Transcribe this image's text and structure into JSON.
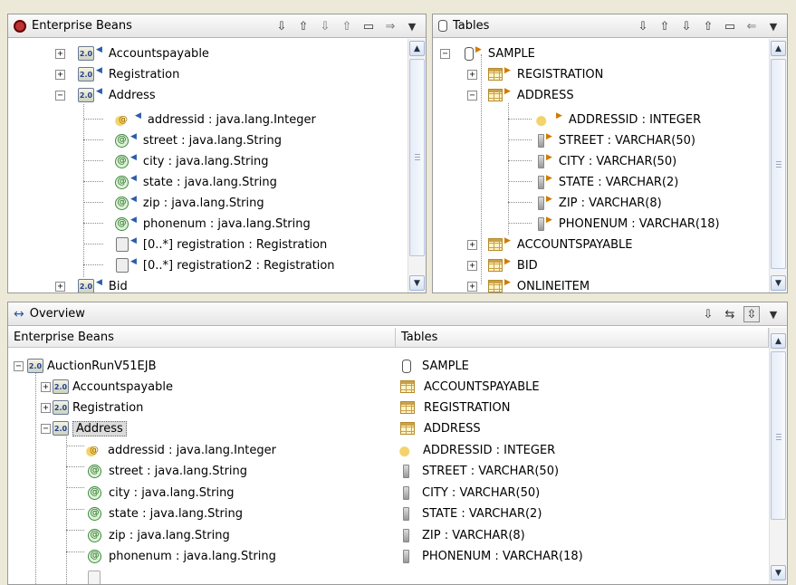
{
  "beans_panel": {
    "title": "Enterprise Beans",
    "rows": [
      {
        "label": "Accountspayable",
        "badge": "2.0"
      },
      {
        "label": "Registration",
        "badge": "2.0"
      },
      {
        "label": "Address",
        "badge": "2.0"
      },
      {
        "label": "addressid : java.lang.Integer",
        "badge": "@"
      },
      {
        "label": "street : java.lang.String",
        "badge": "@"
      },
      {
        "label": "city : java.lang.String",
        "badge": "@"
      },
      {
        "label": "state : java.lang.String",
        "badge": "@"
      },
      {
        "label": "zip : java.lang.String",
        "badge": "@"
      },
      {
        "label": "phonenum : java.lang.String",
        "badge": "@"
      },
      {
        "label": "[0..*] registration : Registration"
      },
      {
        "label": "[0..*] registration2 : Registration"
      },
      {
        "label": "Bid",
        "badge": "2.0"
      }
    ]
  },
  "tables_panel": {
    "title": "Tables",
    "rows": [
      {
        "label": "SAMPLE"
      },
      {
        "label": "REGISTRATION"
      },
      {
        "label": "ADDRESS"
      },
      {
        "label": "ADDRESSID : INTEGER"
      },
      {
        "label": "STREET : VARCHAR(50)"
      },
      {
        "label": "CITY : VARCHAR(50)"
      },
      {
        "label": "STATE : VARCHAR(2)"
      },
      {
        "label": "ZIP : VARCHAR(8)"
      },
      {
        "label": "PHONENUM : VARCHAR(18)"
      },
      {
        "label": "ACCOUNTSPAYABLE"
      },
      {
        "label": "BID"
      },
      {
        "label": "ONLINEITEM"
      }
    ]
  },
  "overview": {
    "title": "Overview",
    "col_beans": "Enterprise Beans",
    "col_tables": "Tables",
    "rows": [
      {
        "bean": "AuctionRunV51EJB",
        "bean_badge": "2.0",
        "table": "SAMPLE"
      },
      {
        "bean": "Accountspayable",
        "bean_badge": "2.0",
        "table": "ACCOUNTSPAYABLE"
      },
      {
        "bean": "Registration",
        "bean_badge": "2.0",
        "table": "REGISTRATION"
      },
      {
        "bean": "Address",
        "bean_badge": "2.0",
        "table": "ADDRESS"
      },
      {
        "bean": "addressid : java.lang.Integer",
        "bean_badge": "@",
        "table": "ADDRESSID : INTEGER"
      },
      {
        "bean": "street : java.lang.String",
        "bean_badge": "@",
        "table": "STREET : VARCHAR(50)"
      },
      {
        "bean": "city : java.lang.String",
        "bean_badge": "@",
        "table": "CITY : VARCHAR(50)"
      },
      {
        "bean": "state : java.lang.String",
        "bean_badge": "@",
        "table": "STATE : VARCHAR(2)"
      },
      {
        "bean": "zip : java.lang.String",
        "bean_badge": "@",
        "table": "ZIP : VARCHAR(8)"
      },
      {
        "bean": "phonenum : java.lang.String",
        "bean_badge": "@",
        "table": "PHONENUM : VARCHAR(18)"
      }
    ]
  },
  "glyphs": {
    "expand": "+",
    "collapse": "−",
    "scroll_up": "▲",
    "scroll_down": "▼",
    "menu": "▼",
    "mark_left": "◀",
    "mark_right": "▶",
    "overview_icon": "↔",
    "tb_a": "⇩",
    "tb_b": "⇧",
    "tb_c": "⇩",
    "tb_d": "⇧",
    "tb_e": "▭",
    "tb_f": "⇒",
    "tb_g": "⇐",
    "ov_a": "⇩",
    "ov_b": "⇆",
    "ov_c": "⇳"
  },
  "icons": {
    "beans_panel": "bean-gear-icon",
    "tables_panel": "table-icon",
    "bean": "ejb-bean-icon",
    "attribute": "attribute-icon",
    "key": "key-attribute-icon",
    "relationship": "relationship-icon",
    "table": "table-icon",
    "database": "database-icon",
    "column": "column-icon"
  },
  "colors": {
    "frame": "#ece9d8",
    "link_marker_left": "#2b5bab",
    "link_marker_right": "#d07a00",
    "attribute_green": "#3b8a3b"
  }
}
